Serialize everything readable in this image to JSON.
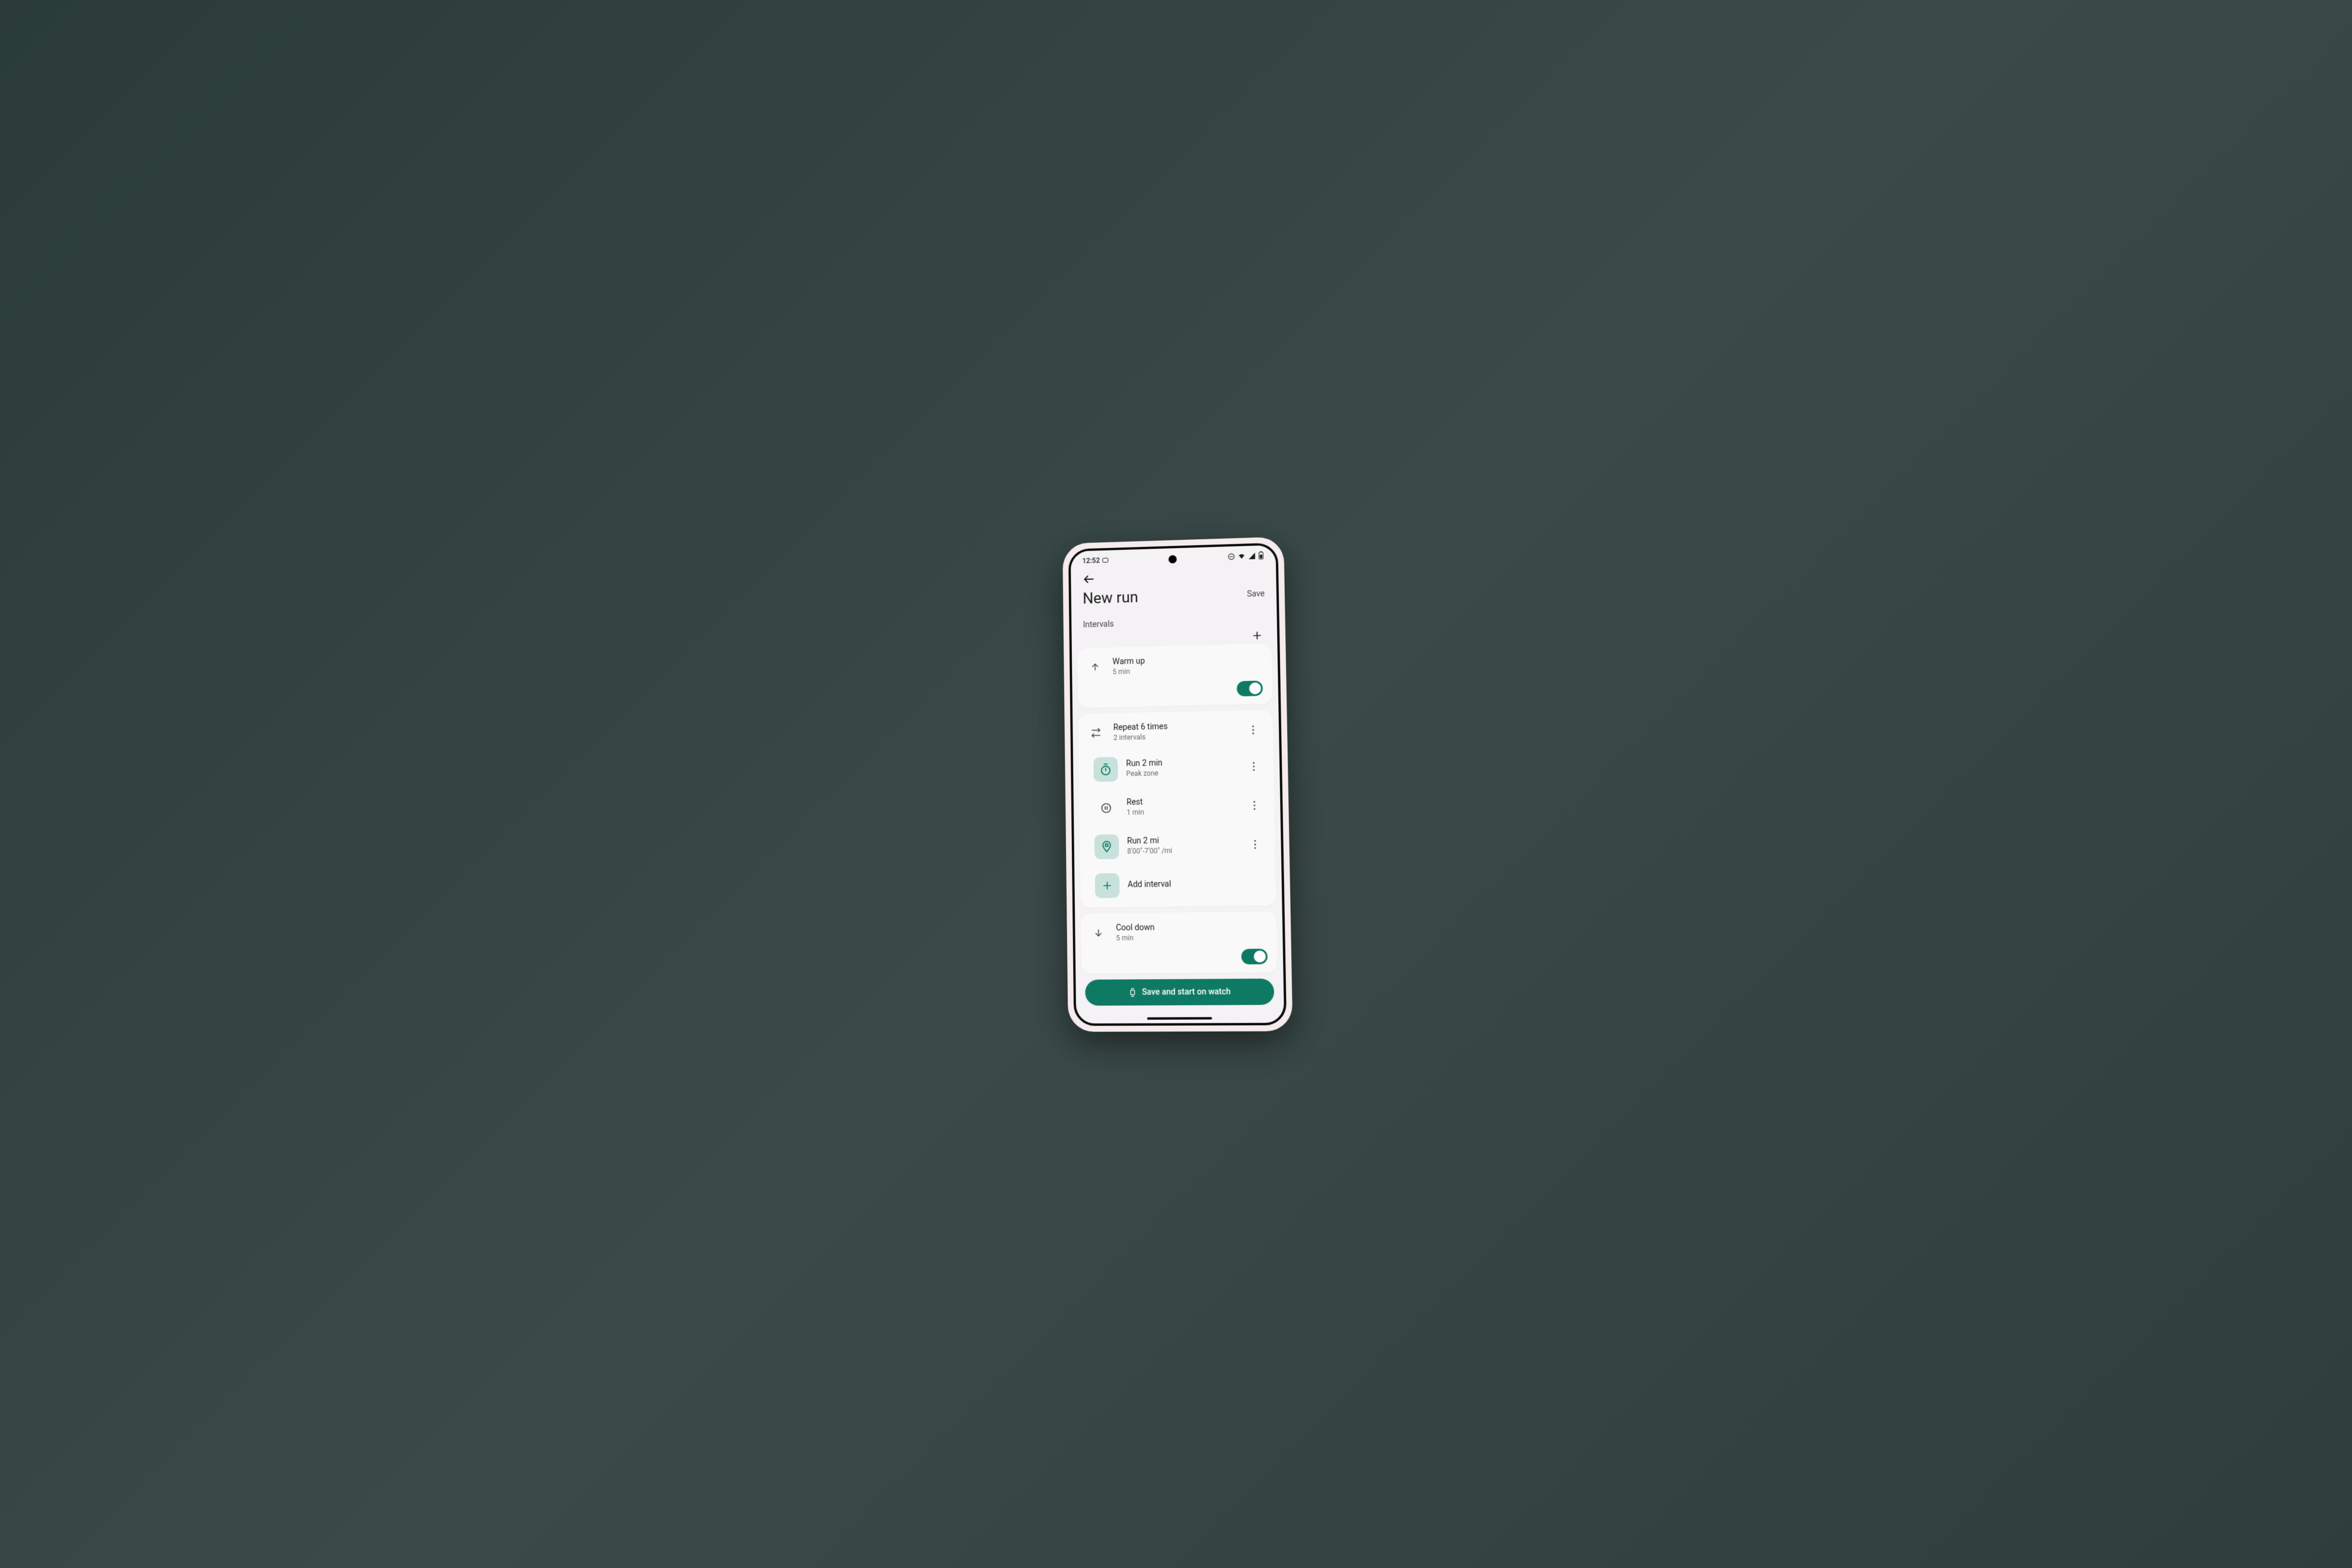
{
  "status": {
    "time": "12:52",
    "icons": [
      "dnd-icon",
      "wifi-icon",
      "signal-icon",
      "battery-icon"
    ]
  },
  "header": {
    "title": "New run",
    "save": "Save"
  },
  "section_label": "Intervals",
  "warmup": {
    "title": "Warm up",
    "sub": "5 min",
    "toggle": true
  },
  "repeat": {
    "title": "Repeat 6 times",
    "sub": "2 intervals",
    "items": [
      {
        "title": "Run 2 min",
        "sub": "Peak zone",
        "icon": "stopwatch"
      },
      {
        "title": "Rest",
        "sub": "1 min",
        "icon": "pause"
      },
      {
        "title": "Run 2 mi",
        "sub": "8'00\"-7'00\" /mi",
        "icon": "pin"
      }
    ],
    "add_label": "Add interval"
  },
  "cooldown": {
    "title": "Cool down",
    "sub": "5 min",
    "toggle": true
  },
  "cta": "Save and start on watch"
}
